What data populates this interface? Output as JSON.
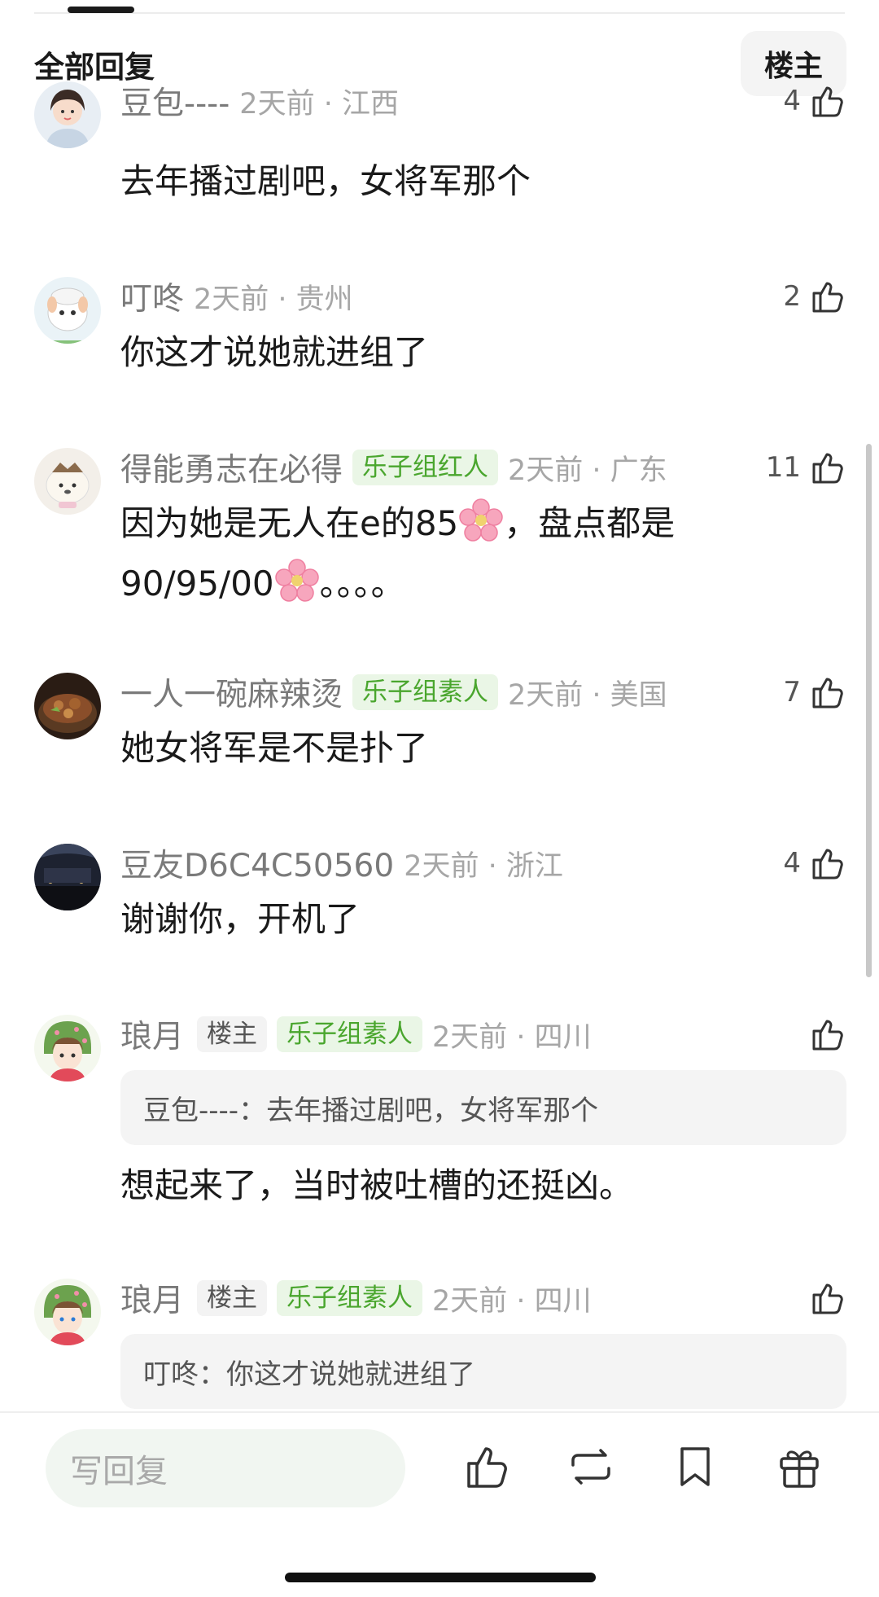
{
  "header": {
    "title": "全部回复",
    "op_filter_label": "楼主"
  },
  "comments": [
    {
      "username": "豆包----",
      "time_location": "2天前 · 江西",
      "text": "去年播过剧吧，女将军那个",
      "likes": "4"
    },
    {
      "username": "叮咚",
      "time_location": "2天前 · 贵州",
      "text": "你这才说她就进组了",
      "likes": "2"
    },
    {
      "username": "得能勇志在必得",
      "badge": "乐子组红人",
      "time_location": "2天前 · 广东",
      "text_line1_a": "因为她是无人在e的85",
      "text_line1_b": "，盘点都是",
      "text_line2_a": "90/95/00",
      "text_line2_b": "。。。。",
      "emoji_name": "cherry-blossom",
      "likes": "11"
    },
    {
      "username": "一人一碗麻辣烫",
      "badge": "乐子组素人",
      "time_location": "2天前 · 美国",
      "text": "她女将军是不是扑了",
      "likes": "7"
    },
    {
      "username": "豆友D6C4C50560",
      "time_location": "2天前 · 浙江",
      "text": "谢谢你，开机了",
      "likes": "4"
    },
    {
      "username": "琅月",
      "op_badge": "楼主",
      "badge": "乐子组素人",
      "time_location": "2天前 · 四川",
      "quote": "豆包----：去年播过剧吧，女将军那个",
      "text": "想起来了，当时被吐槽的还挺凶。",
      "likes": ""
    },
    {
      "username": "琅月",
      "op_badge": "楼主",
      "badge": "乐子组素人",
      "time_location": "2天前 · 四川",
      "quote": "叮咚：你这才说她就进组了",
      "likes": ""
    }
  ],
  "bottom_bar": {
    "reply_placeholder": "写回复",
    "icons": [
      "thumbs-up-icon",
      "repost-icon",
      "bookmark-icon",
      "gift-icon"
    ]
  },
  "colors": {
    "group_badge_text": "#4aa62e",
    "group_badge_bg": "#eaf6e6",
    "meta_gray": "#a6a6a6"
  }
}
